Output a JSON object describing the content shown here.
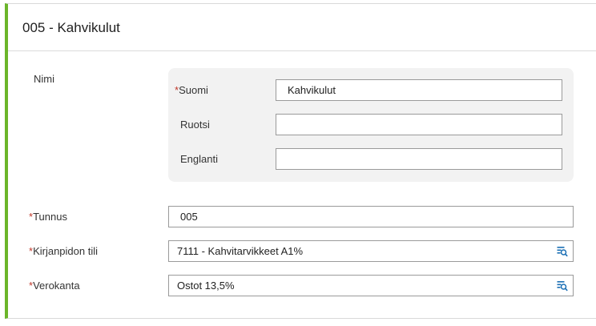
{
  "header": {
    "title": "005 - Kahvikulut"
  },
  "name_section": {
    "label": "Nimi",
    "languages": [
      {
        "label": "Suomi",
        "required": true,
        "value": "Kahvikulut"
      },
      {
        "label": "Ruotsi",
        "required": false,
        "value": ""
      },
      {
        "label": "Englanti",
        "required": false,
        "value": ""
      }
    ]
  },
  "fields": {
    "tunnus": {
      "label": "Tunnus",
      "required": true,
      "value": "005"
    },
    "kirjanpidon_tili": {
      "label": "Kirjanpidon tili",
      "required": true,
      "value": "7111 - Kahvitarvikkeet A1%",
      "icon": "lookup-icon"
    },
    "verokanta": {
      "label": "Verokanta",
      "required": true,
      "value": "Ostot 13,5%",
      "icon": "lookup-icon"
    }
  },
  "required_marker": "*",
  "colors": {
    "accent": "#6bb52a",
    "required": "#c0392b",
    "icon": "#1a6fb5"
  }
}
